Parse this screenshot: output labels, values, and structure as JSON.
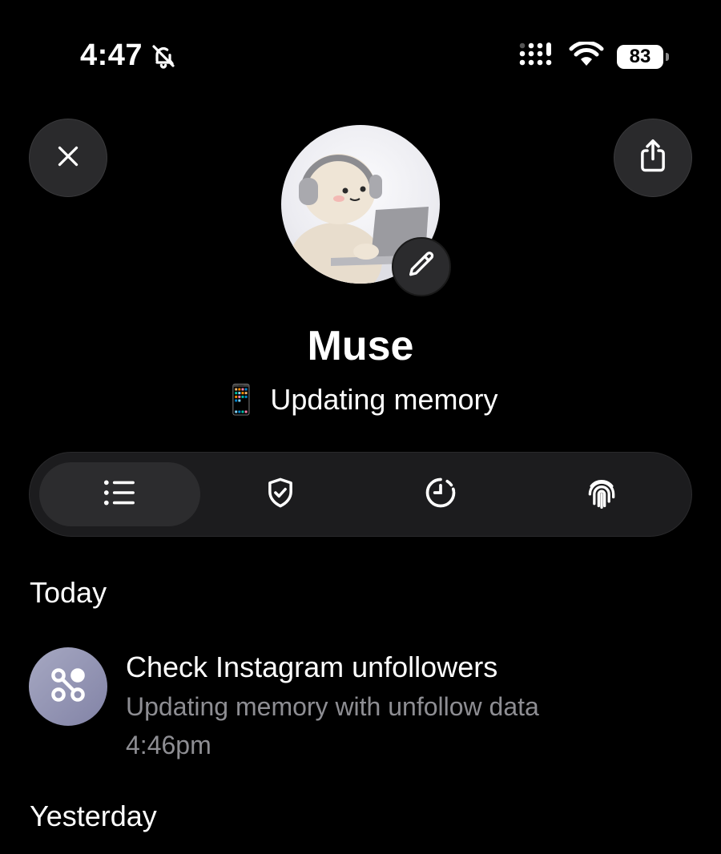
{
  "status_bar": {
    "time": "4:47",
    "silent_icon": "bell-slash-icon",
    "signal_icon": "cellular-signal-icon",
    "wifi_icon": "wifi-icon",
    "battery": "83"
  },
  "header": {
    "close_icon": "close-icon",
    "share_icon": "share-icon",
    "edit_icon": "pencil-icon"
  },
  "profile": {
    "name": "Muse",
    "status_emoji": "📱",
    "status_text": "Updating memory"
  },
  "tabs": [
    {
      "icon": "list-icon",
      "active": true
    },
    {
      "icon": "shield-check-icon",
      "active": false
    },
    {
      "icon": "clock-icon",
      "active": false
    },
    {
      "icon": "fingerprint-icon",
      "active": false
    }
  ],
  "sections": {
    "today": "Today",
    "yesterday": "Yesterday"
  },
  "activity": [
    {
      "icon": "workflow-icon",
      "title": "Check Instagram unfollowers",
      "subtitle": "Updating memory with unfollow data",
      "time": "4:46pm"
    }
  ],
  "colors": {
    "background": "#000000",
    "surface": "#1c1c1e",
    "active_tab": "#2c2c2e",
    "secondary_text": "#8e8e93",
    "item_icon_bg": "#9496b5"
  }
}
